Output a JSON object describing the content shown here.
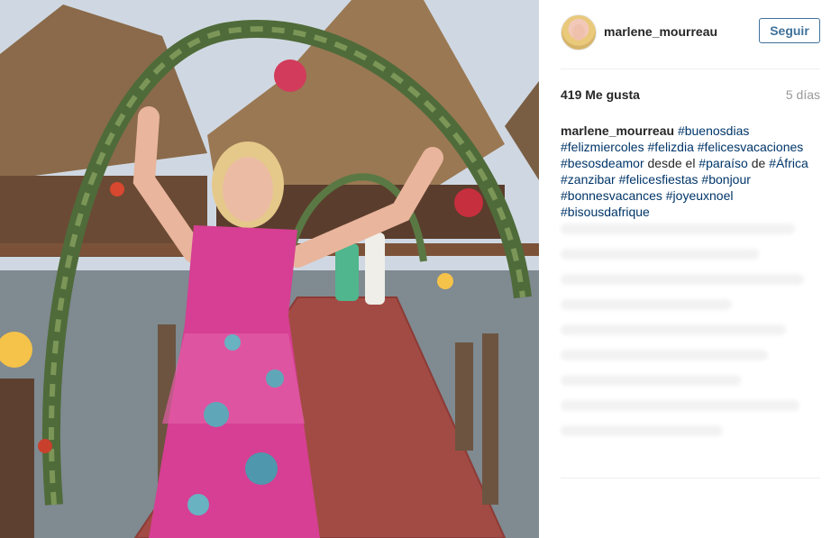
{
  "post": {
    "username": "marlene_mourreau",
    "follow_label": "Seguir",
    "likes": "419 Me gusta",
    "age": "5 días",
    "caption": [
      {
        "type": "user",
        "text": "marlene_mourreau"
      },
      {
        "type": "text",
        "text": " "
      },
      {
        "type": "tag",
        "text": "#buenosdias"
      },
      {
        "type": "text",
        "text": " "
      },
      {
        "type": "tag",
        "text": "#felizmiercoles"
      },
      {
        "type": "text",
        "text": " "
      },
      {
        "type": "tag",
        "text": "#felizdia"
      },
      {
        "type": "text",
        "text": " "
      },
      {
        "type": "tag",
        "text": "#felicesvacaciones"
      },
      {
        "type": "text",
        "text": " "
      },
      {
        "type": "tag",
        "text": "#besosdeamor"
      },
      {
        "type": "text",
        "text": " desde el "
      },
      {
        "type": "tag",
        "text": "#paraíso"
      },
      {
        "type": "text",
        "text": " de "
      },
      {
        "type": "tag",
        "text": "#África"
      },
      {
        "type": "text",
        "text": " "
      },
      {
        "type": "tag",
        "text": "#zanzibar"
      },
      {
        "type": "text",
        "text": " "
      },
      {
        "type": "tag",
        "text": "#felicesfiestas"
      },
      {
        "type": "text",
        "text": " "
      },
      {
        "type": "tag",
        "text": "#bonjour"
      },
      {
        "type": "text",
        "text": " "
      },
      {
        "type": "tag",
        "text": "#bonnesvacances"
      },
      {
        "type": "text",
        "text": " "
      },
      {
        "type": "tag",
        "text": "#joyeuxnoel"
      },
      {
        "type": "text",
        "text": " "
      },
      {
        "type": "tag",
        "text": "#bisousdafrique"
      }
    ]
  },
  "colors": {
    "link": "#003569",
    "follow_blue": "#3f729b",
    "muted": "#999999",
    "text": "#262626"
  },
  "icons": {
    "avatar": "profile-avatar"
  }
}
